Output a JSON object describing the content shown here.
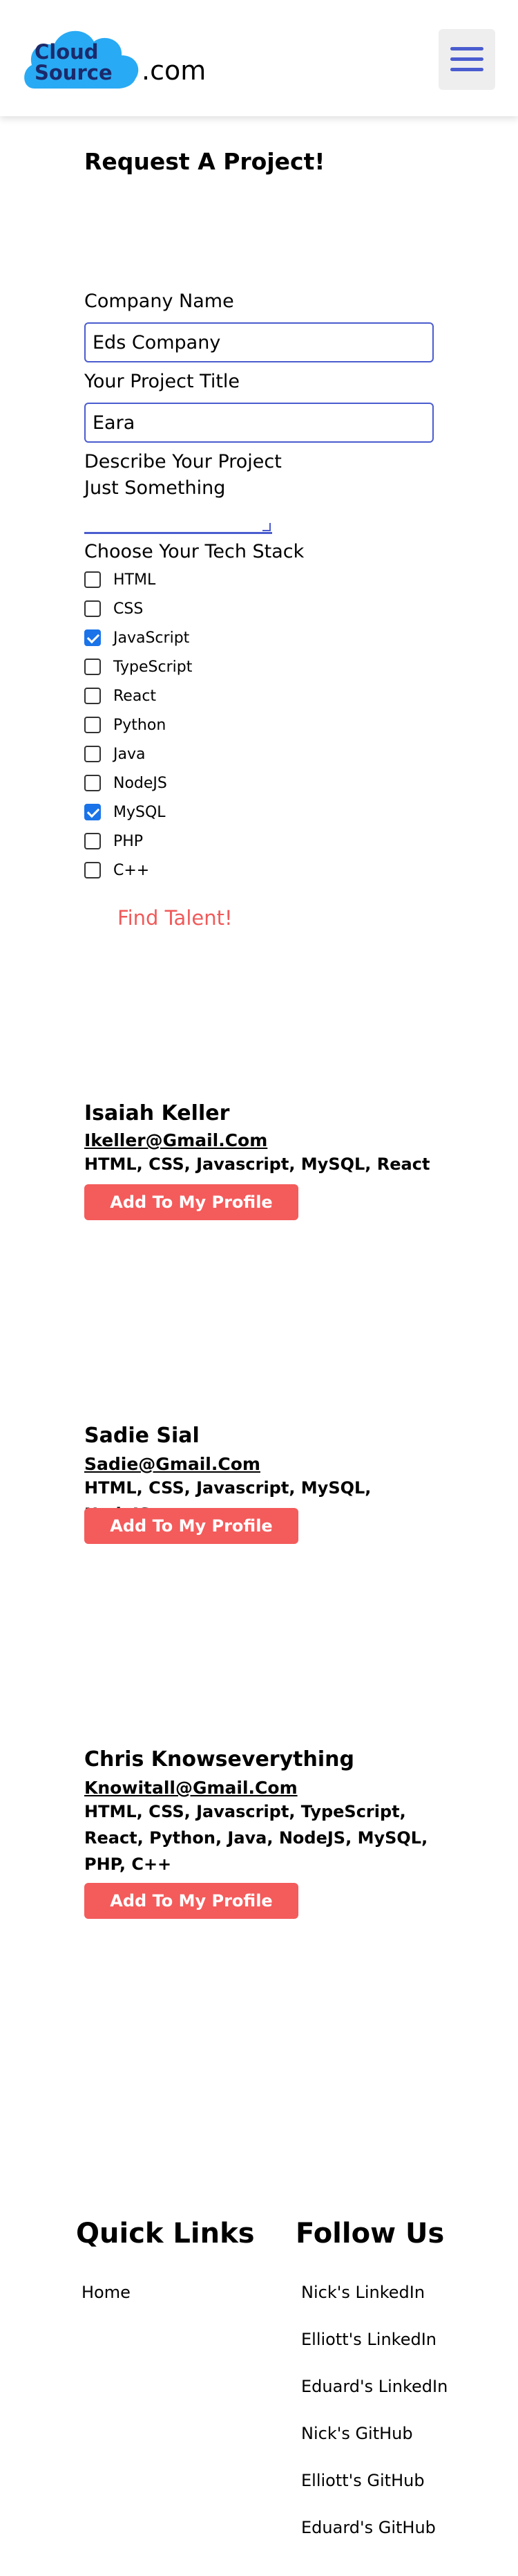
{
  "header": {
    "logo_line1": "Cloud",
    "logo_line2": "Source",
    "logo_suffix": ".com",
    "logo_color": "#29aaf4",
    "menu_icon": "hamburger-icon"
  },
  "form": {
    "title": "Request A Project!",
    "company_label": "Company Name",
    "company_value": "Eds Company",
    "project_title_label": "Your Project Title",
    "project_title_value": "Eara",
    "describe_label": "Describe Your Project",
    "describe_value": "Just Something",
    "tech_label": "Choose Your Tech Stack",
    "tech_options": [
      {
        "label": "HTML",
        "checked": false
      },
      {
        "label": "CSS",
        "checked": false
      },
      {
        "label": "JavaScript",
        "checked": true
      },
      {
        "label": "TypeScript",
        "checked": false
      },
      {
        "label": "React",
        "checked": false
      },
      {
        "label": "Python",
        "checked": false
      },
      {
        "label": "Java",
        "checked": false
      },
      {
        "label": "NodeJS",
        "checked": false
      },
      {
        "label": "MySQL",
        "checked": true
      },
      {
        "label": "PHP",
        "checked": false
      },
      {
        "label": "C++",
        "checked": false
      }
    ],
    "submit_label": "Find Talent!"
  },
  "talents": [
    {
      "name": "Isaiah Keller",
      "email": "Ikeller@Gmail.Com",
      "skills": "HTML, CSS, Javascript, MySQL, React",
      "button": "Add To My Profile"
    },
    {
      "name": "Sadie Sial",
      "email": "Sadie@Gmail.Com",
      "skills": "HTML, CSS, Javascript, MySQL, NodeJS",
      "button": "Add To My Profile"
    },
    {
      "name": "Chris Knowseverything",
      "email": "Knowitall@Gmail.Com",
      "skills": "HTML, CSS, Javascript, TypeScript, React, Python, Java, NodeJS, MySQL, PHP, C++",
      "button": "Add To My Profile"
    }
  ],
  "footer": {
    "quick_links_heading": "Quick Links",
    "quick_links": [
      "Home"
    ],
    "follow_heading": "Follow Us",
    "follow_links": [
      "Nick's LinkedIn",
      "Elliott's LinkedIn",
      "Eduard's LinkedIn",
      "Nick's GitHub",
      "Elliott's GitHub",
      "Eduard's GitHub"
    ]
  },
  "colors": {
    "accent": "#4a5ccf",
    "button": "#f45b5b",
    "find_talent": "#f05a5a",
    "checkbox_checked": "#1a73e8"
  }
}
